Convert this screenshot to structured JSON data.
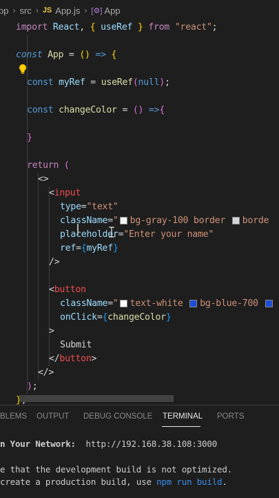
{
  "breadcrumb": {
    "root": "pp",
    "folder": "src",
    "file_badge": "JS",
    "file": "App.js",
    "symbol_icon": "component-icon",
    "symbol": "App"
  },
  "code": {
    "l1_import": "import",
    "l1_react": "React",
    "l1_hook": "useRef",
    "l1_from": "from",
    "l1_src": "\"react\"",
    "l3_const": "const",
    "l3_name": "App",
    "l5_const": "const",
    "l5_var": "myRef",
    "l5_hook": "useRef",
    "l5_null": "null",
    "l7_const": "const",
    "l7_fn": "changeColor",
    "l11_return": "return",
    "l14_tag": "input",
    "l15_attr": "type",
    "l15_val": "\"text\"",
    "l16_attr": "className",
    "l16_val1": "bg-gray-100 border",
    "l16_val2": "borde",
    "l17_attr": "placeholder",
    "l17_val": "\"Enter your name\"",
    "l18_attr": "ref",
    "l18_val": "myRef",
    "l21_tag": "button",
    "l22_attr": "className",
    "l22_val1": "text-white",
    "l22_val2": "bg-blue-700",
    "l23_attr": "onClick",
    "l23_val": "changeColor",
    "l25_text": "Submit",
    "l26_tag": "button"
  },
  "panel": {
    "tabs": [
      "PROBLEMS",
      "OUTPUT",
      "DEBUG CONSOLE",
      "TERMINAL",
      "PORTS"
    ],
    "tab_visible": [
      "BLEMS",
      "OUTPUT",
      "DEBUG CONSOLE",
      "TERMINAL",
      "PORTS"
    ],
    "active_tab": "TERMINAL",
    "terminal": {
      "network_label": "n Your Network:",
      "network_url": "http://192.168.38.108:3000",
      "note1": "e that the development build is not optimized.",
      "note2_a": "create a production build, use ",
      "note2_cmd": "npm run build",
      "note2_b": "."
    }
  },
  "colors": {
    "background": "#1e1e1e",
    "keyword": "#c586c0",
    "storage": "#569cd6",
    "variable": "#9cdcfe",
    "function": "#dcdcaa",
    "string": "#ce9178",
    "jsx_tag": "#f14c4c",
    "swatch_gray_100": "#f3f4f6",
    "swatch_white": "#ffffff",
    "swatch_blue_700": "#1d4ed8"
  }
}
